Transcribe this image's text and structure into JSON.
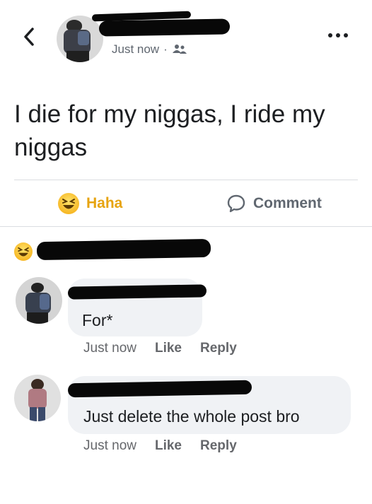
{
  "header": {
    "timestamp": "Just now",
    "separator": "·",
    "audience_icon": "friends-icon",
    "back_icon": "chevron-left-icon",
    "more_icon": "more-dots-icon"
  },
  "post": {
    "text": "I die for my niggas, I ride my niggas"
  },
  "actions": {
    "haha_label": "Haha",
    "comment_label": "Comment"
  },
  "comments": [
    {
      "text": "For*",
      "time": "Just now",
      "like": "Like",
      "reply": "Reply"
    },
    {
      "text": "Just delete the whole post bro",
      "time": "Just now",
      "like": "Like",
      "reply": "Reply"
    }
  ],
  "colors": {
    "haha": "#e7a411",
    "text_secondary": "#65676b",
    "bubble": "#f0f2f5",
    "redaction": "#080808"
  }
}
